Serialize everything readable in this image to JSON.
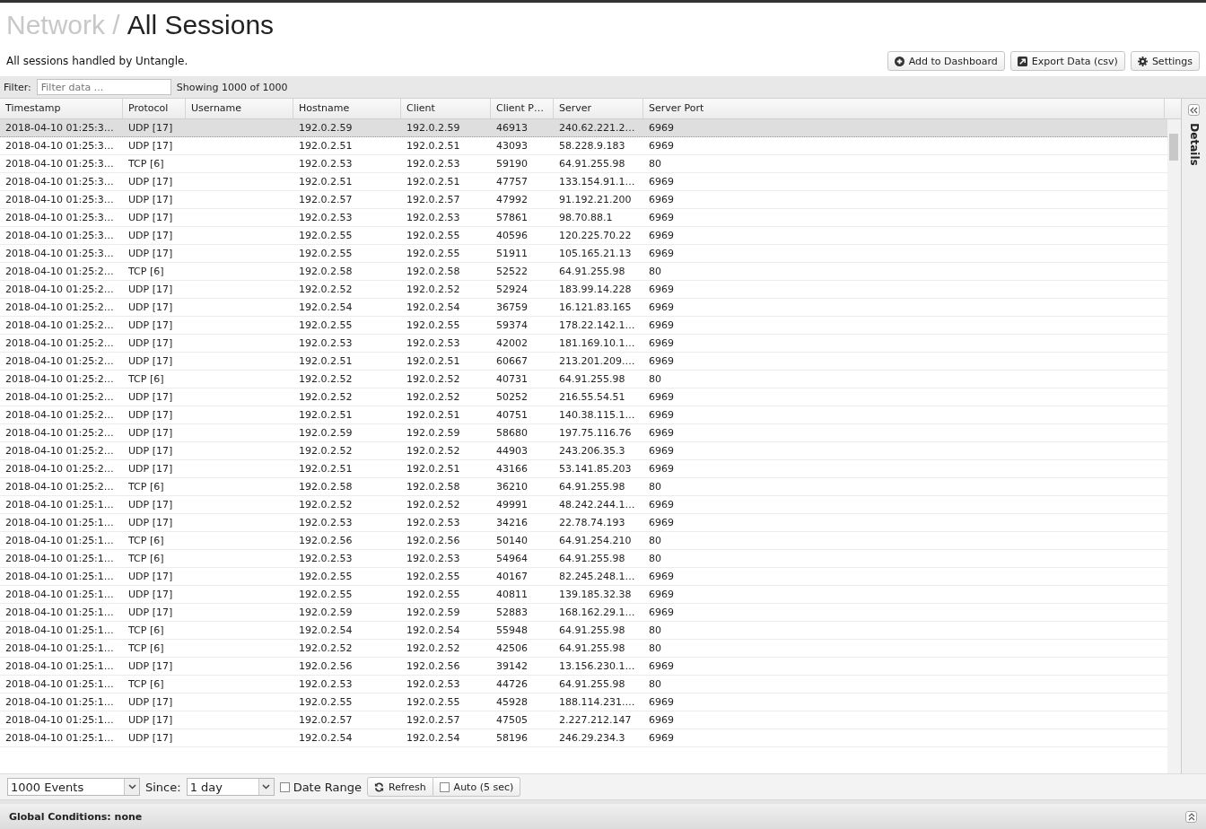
{
  "header": {
    "breadcrumb_parent": "Network /",
    "title": "All Sessions",
    "description": "All sessions handled by Untangle."
  },
  "actions": [
    {
      "kind": "add",
      "label": "Add to Dashboard"
    },
    {
      "kind": "export",
      "label": "Export Data (csv)"
    },
    {
      "kind": "settings",
      "label": "Settings"
    }
  ],
  "filter": {
    "label": "Filter:",
    "placeholder": "Filter data ...",
    "count": "Showing 1000 of 1000"
  },
  "table": {
    "columns": [
      {
        "label": "Timestamp"
      },
      {
        "label": "Protocol"
      },
      {
        "label": "Username"
      },
      {
        "label": "Hostname"
      },
      {
        "label": "Client"
      },
      {
        "label": "Client P…"
      },
      {
        "label": "Server"
      },
      {
        "label": "Server Port"
      }
    ],
    "rows": [
      {
        "selected": true,
        "timestamp": "2018-04-10 01:25:3…",
        "protocol": "UDP [17]",
        "hostname": "192.0.2.59",
        "client": "192.0.2.59",
        "client_port": "46913",
        "server": "240.62.221.2…",
        "server_port": "6969"
      },
      {
        "selected": false,
        "timestamp": "2018-04-10 01:25:3…",
        "protocol": "UDP [17]",
        "hostname": "192.0.2.51",
        "client": "192.0.2.51",
        "client_port": "43093",
        "server": "58.228.9.183",
        "server_port": "6969"
      },
      {
        "selected": false,
        "timestamp": "2018-04-10 01:25:3…",
        "protocol": "TCP [6]",
        "hostname": "192.0.2.53",
        "client": "192.0.2.53",
        "client_port": "59190",
        "server": "64.91.255.98",
        "server_port": "80"
      },
      {
        "selected": false,
        "timestamp": "2018-04-10 01:25:3…",
        "protocol": "UDP [17]",
        "hostname": "192.0.2.51",
        "client": "192.0.2.51",
        "client_port": "47757",
        "server": "133.154.91.1…",
        "server_port": "6969"
      },
      {
        "selected": false,
        "timestamp": "2018-04-10 01:25:3…",
        "protocol": "UDP [17]",
        "hostname": "192.0.2.57",
        "client": "192.0.2.57",
        "client_port": "47992",
        "server": "91.192.21.200",
        "server_port": "6969"
      },
      {
        "selected": false,
        "timestamp": "2018-04-10 01:25:3…",
        "protocol": "UDP [17]",
        "hostname": "192.0.2.53",
        "client": "192.0.2.53",
        "client_port": "57861",
        "server": "98.70.88.1",
        "server_port": "6969"
      },
      {
        "selected": false,
        "timestamp": "2018-04-10 01:25:3…",
        "protocol": "UDP [17]",
        "hostname": "192.0.2.55",
        "client": "192.0.2.55",
        "client_port": "40596",
        "server": "120.225.70.22",
        "server_port": "6969"
      },
      {
        "selected": false,
        "timestamp": "2018-04-10 01:25:3…",
        "protocol": "UDP [17]",
        "hostname": "192.0.2.55",
        "client": "192.0.2.55",
        "client_port": "51911",
        "server": "105.165.21.13",
        "server_port": "6969"
      },
      {
        "selected": false,
        "timestamp": "2018-04-10 01:25:2…",
        "protocol": "TCP [6]",
        "hostname": "192.0.2.58",
        "client": "192.0.2.58",
        "client_port": "52522",
        "server": "64.91.255.98",
        "server_port": "80"
      },
      {
        "selected": false,
        "timestamp": "2018-04-10 01:25:2…",
        "protocol": "UDP [17]",
        "hostname": "192.0.2.52",
        "client": "192.0.2.52",
        "client_port": "52924",
        "server": "183.99.14.228",
        "server_port": "6969"
      },
      {
        "selected": false,
        "timestamp": "2018-04-10 01:25:2…",
        "protocol": "UDP [17]",
        "hostname": "192.0.2.54",
        "client": "192.0.2.54",
        "client_port": "36759",
        "server": "16.121.83.165",
        "server_port": "6969"
      },
      {
        "selected": false,
        "timestamp": "2018-04-10 01:25:2…",
        "protocol": "UDP [17]",
        "hostname": "192.0.2.55",
        "client": "192.0.2.55",
        "client_port": "59374",
        "server": "178.22.142.1…",
        "server_port": "6969"
      },
      {
        "selected": false,
        "timestamp": "2018-04-10 01:25:2…",
        "protocol": "UDP [17]",
        "hostname": "192.0.2.53",
        "client": "192.0.2.53",
        "client_port": "42002",
        "server": "181.169.10.1…",
        "server_port": "6969"
      },
      {
        "selected": false,
        "timestamp": "2018-04-10 01:25:2…",
        "protocol": "UDP [17]",
        "hostname": "192.0.2.51",
        "client": "192.0.2.51",
        "client_port": "60667",
        "server": "213.201.209.…",
        "server_port": "6969"
      },
      {
        "selected": false,
        "timestamp": "2018-04-10 01:25:2…",
        "protocol": "TCP [6]",
        "hostname": "192.0.2.52",
        "client": "192.0.2.52",
        "client_port": "40731",
        "server": "64.91.255.98",
        "server_port": "80"
      },
      {
        "selected": false,
        "timestamp": "2018-04-10 01:25:2…",
        "protocol": "UDP [17]",
        "hostname": "192.0.2.52",
        "client": "192.0.2.52",
        "client_port": "50252",
        "server": "216.55.54.51",
        "server_port": "6969"
      },
      {
        "selected": false,
        "timestamp": "2018-04-10 01:25:2…",
        "protocol": "UDP [17]",
        "hostname": "192.0.2.51",
        "client": "192.0.2.51",
        "client_port": "40751",
        "server": "140.38.115.1…",
        "server_port": "6969"
      },
      {
        "selected": false,
        "timestamp": "2018-04-10 01:25:2…",
        "protocol": "UDP [17]",
        "hostname": "192.0.2.59",
        "client": "192.0.2.59",
        "client_port": "58680",
        "server": "197.75.116.76",
        "server_port": "6969"
      },
      {
        "selected": false,
        "timestamp": "2018-04-10 01:25:2…",
        "protocol": "UDP [17]",
        "hostname": "192.0.2.52",
        "client": "192.0.2.52",
        "client_port": "44903",
        "server": "243.206.35.3",
        "server_port": "6969"
      },
      {
        "selected": false,
        "timestamp": "2018-04-10 01:25:2…",
        "protocol": "UDP [17]",
        "hostname": "192.0.2.51",
        "client": "192.0.2.51",
        "client_port": "43166",
        "server": "53.141.85.203",
        "server_port": "6969"
      },
      {
        "selected": false,
        "timestamp": "2018-04-10 01:25:2…",
        "protocol": "TCP [6]",
        "hostname": "192.0.2.58",
        "client": "192.0.2.58",
        "client_port": "36210",
        "server": "64.91.255.98",
        "server_port": "80"
      },
      {
        "selected": false,
        "timestamp": "2018-04-10 01:25:1…",
        "protocol": "UDP [17]",
        "hostname": "192.0.2.52",
        "client": "192.0.2.52",
        "client_port": "49991",
        "server": "48.242.244.1…",
        "server_port": "6969"
      },
      {
        "selected": false,
        "timestamp": "2018-04-10 01:25:1…",
        "protocol": "UDP [17]",
        "hostname": "192.0.2.53",
        "client": "192.0.2.53",
        "client_port": "34216",
        "server": "22.78.74.193",
        "server_port": "6969"
      },
      {
        "selected": false,
        "timestamp": "2018-04-10 01:25:1…",
        "protocol": "TCP [6]",
        "hostname": "192.0.2.56",
        "client": "192.0.2.56",
        "client_port": "50140",
        "server": "64.91.254.210",
        "server_port": "80"
      },
      {
        "selected": false,
        "timestamp": "2018-04-10 01:25:1…",
        "protocol": "TCP [6]",
        "hostname": "192.0.2.53",
        "client": "192.0.2.53",
        "client_port": "54964",
        "server": "64.91.255.98",
        "server_port": "80"
      },
      {
        "selected": false,
        "timestamp": "2018-04-10 01:25:1…",
        "protocol": "UDP [17]",
        "hostname": "192.0.2.55",
        "client": "192.0.2.55",
        "client_port": "40167",
        "server": "82.245.248.1…",
        "server_port": "6969"
      },
      {
        "selected": false,
        "timestamp": "2018-04-10 01:25:1…",
        "protocol": "UDP [17]",
        "hostname": "192.0.2.55",
        "client": "192.0.2.55",
        "client_port": "40811",
        "server": "139.185.32.38",
        "server_port": "6969"
      },
      {
        "selected": false,
        "timestamp": "2018-04-10 01:25:1…",
        "protocol": "UDP [17]",
        "hostname": "192.0.2.59",
        "client": "192.0.2.59",
        "client_port": "52883",
        "server": "168.162.29.1…",
        "server_port": "6969"
      },
      {
        "selected": false,
        "timestamp": "2018-04-10 01:25:1…",
        "protocol": "TCP [6]",
        "hostname": "192.0.2.54",
        "client": "192.0.2.54",
        "client_port": "55948",
        "server": "64.91.255.98",
        "server_port": "80"
      },
      {
        "selected": false,
        "timestamp": "2018-04-10 01:25:1…",
        "protocol": "TCP [6]",
        "hostname": "192.0.2.52",
        "client": "192.0.2.52",
        "client_port": "42506",
        "server": "64.91.255.98",
        "server_port": "80"
      },
      {
        "selected": false,
        "timestamp": "2018-04-10 01:25:1…",
        "protocol": "UDP [17]",
        "hostname": "192.0.2.56",
        "client": "192.0.2.56",
        "client_port": "39142",
        "server": "13.156.230.1…",
        "server_port": "6969"
      },
      {
        "selected": false,
        "timestamp": "2018-04-10 01:25:1…",
        "protocol": "TCP [6]",
        "hostname": "192.0.2.53",
        "client": "192.0.2.53",
        "client_port": "44726",
        "server": "64.91.255.98",
        "server_port": "80"
      },
      {
        "selected": false,
        "timestamp": "2018-04-10 01:25:1…",
        "protocol": "UDP [17]",
        "hostname": "192.0.2.55",
        "client": "192.0.2.55",
        "client_port": "45928",
        "server": "188.114.231.…",
        "server_port": "6969"
      },
      {
        "selected": false,
        "timestamp": "2018-04-10 01:25:1…",
        "protocol": "UDP [17]",
        "hostname": "192.0.2.57",
        "client": "192.0.2.57",
        "client_port": "47505",
        "server": "2.227.212.147",
        "server_port": "6969"
      },
      {
        "selected": false,
        "timestamp": "2018-04-10 01:25:1…",
        "protocol": "UDP [17]",
        "hostname": "192.0.2.54",
        "client": "192.0.2.54",
        "client_port": "58196",
        "server": "246.29.234.3",
        "server_port": "6969"
      }
    ]
  },
  "details_panel": {
    "title": "Details"
  },
  "toolbar": {
    "limit": "1000 Events",
    "since_label": "Since:",
    "since": "1 day",
    "date_range": {
      "label": "Date Range",
      "checked": false
    },
    "refresh": "Refresh",
    "auto": {
      "label": "Auto (5 sec)",
      "checked": false
    }
  },
  "global_conditions": {
    "label": "Global Conditions: none"
  }
}
